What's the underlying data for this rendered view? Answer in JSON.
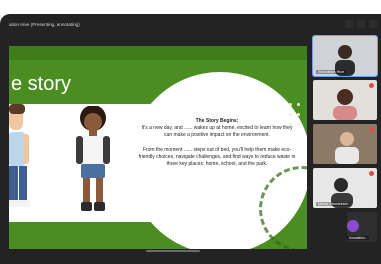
{
  "window": {
    "title": "ation Hive (Presenting, annotating)"
  },
  "slide": {
    "title": "e story",
    "story_heading": "The Story Begins:",
    "paragraph1": "It's a new day, and ...... wakes up at home, excited to learn how they can make a positive impact on the environment.",
    "paragraph2": "From the moment ...... steps out of bed, you'll help them make eco-friendly choices, navigate challenges, and find ways to reduce waste in three key places: home, school, and the park."
  },
  "participants": [
    {
      "name": "Innovation Hive"
    },
    {
      "name": ""
    },
    {
      "name": ""
    },
    {
      "name": "Monia Sfondrinich"
    },
    {
      "name": "Innovation..."
    }
  ],
  "colors": {
    "slide_green": "#4a8e22",
    "app_bg": "#232323",
    "active_border": "#6aa0ff"
  }
}
